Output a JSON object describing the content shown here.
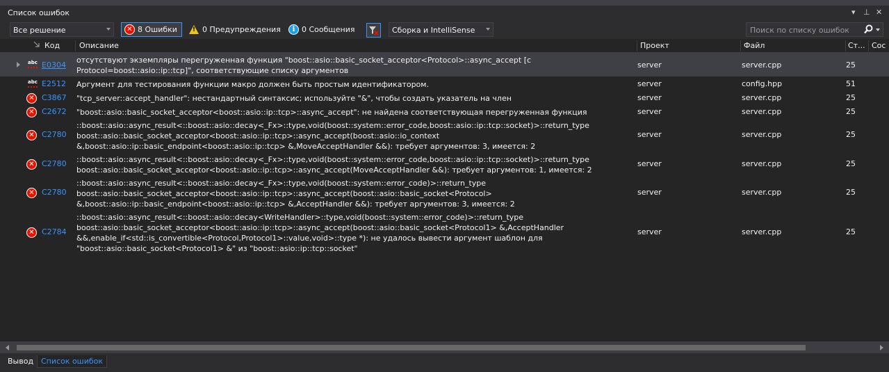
{
  "window": {
    "title": "Список ошибок"
  },
  "toolbar": {
    "scope": "Все решение",
    "errors": "8 Ошибки",
    "warnings": "0 Предупреждения",
    "messages": "0 Сообщения",
    "build_source": "Сборка и IntelliSense",
    "search_placeholder": "Поиск по списку ошибок"
  },
  "columns": {
    "code": "Код",
    "description": "Описание",
    "project": "Проект",
    "file": "Файл",
    "line": "Ст...",
    "suppression": "Сос"
  },
  "rows": [
    {
      "icon": "intellisense-error-icon",
      "code": "E0304",
      "description": "отсутствуют экземпляры перегруженная функция \"boost::asio::basic_socket_acceptor<Protocol>::async_accept [с Protocol=boost::asio::ip::tcp]\", соответствующие списку аргументов",
      "project": "server",
      "file": "server.cpp",
      "line": "25"
    },
    {
      "icon": "intellisense-error-icon",
      "code": "E2512",
      "description": "Аргумент для тестирования функции макро должен быть простым идентификатором.",
      "project": "server",
      "file": "config.hpp",
      "line": "51"
    },
    {
      "icon": "error-icon",
      "code": "C3867",
      "description": "\"tcp_server::accept_handler\": нестандартный синтаксис; используйте \"&\", чтобы создать указатель на член",
      "project": "server",
      "file": "server.cpp",
      "line": "25"
    },
    {
      "icon": "error-icon",
      "code": "C2672",
      "description": "\"boost::asio::basic_socket_acceptor<boost::asio::ip::tcp>::async_accept\": не найдена соответствующая перегруженная функция",
      "project": "server",
      "file": "server.cpp",
      "line": "25"
    },
    {
      "icon": "error-icon",
      "code": "C2780",
      "description": "::boost::asio::async_result<::boost::asio::decay<_Fx>::type,void(boost::system::error_code,boost::asio::ip::tcp::socket)>::return_type boost::asio::basic_socket_acceptor<boost::asio::ip::tcp>::async_accept(boost::asio::io_context &,boost::asio::ip::basic_endpoint<boost::asio::ip::tcp> &,MoveAcceptHandler &&): требует аргументов: 3, имеется: 2",
      "project": "server",
      "file": "server.cpp",
      "line": "25"
    },
    {
      "icon": "error-icon",
      "code": "C2780",
      "description": "::boost::asio::async_result<::boost::asio::decay<_Fx>::type,void(boost::system::error_code,boost::asio::ip::tcp::socket)>::return_type boost::asio::basic_socket_acceptor<boost::asio::ip::tcp>::async_accept(MoveAcceptHandler &&): требует аргументов: 1, имеется: 2",
      "project": "server",
      "file": "server.cpp",
      "line": "25"
    },
    {
      "icon": "error-icon",
      "code": "C2780",
      "description": "::boost::asio::async_result<::boost::asio::decay<_Fx>::type,void(boost::system::error_code)>::return_type boost::asio::basic_socket_acceptor<boost::asio::ip::tcp>::async_accept(boost::asio::basic_socket<Protocol> &,boost::asio::ip::basic_endpoint<boost::asio::ip::tcp> &,AcceptHandler &&): требует аргументов: 3, имеется: 2",
      "project": "server",
      "file": "server.cpp",
      "line": "25"
    },
    {
      "icon": "error-icon",
      "code": "C2784",
      "description": "::boost::asio::async_result<::boost::asio::decay<WriteHandler>::type,void(boost::system::error_code)>::return_type boost::asio::basic_socket_acceptor<boost::asio::ip::tcp>::async_accept(boost::asio::basic_socket<Protocol1> &,AcceptHandler &&,enable_if<std::is_convertible<Protocol,Protocol1>::value,void>::type *): не удалось вывести аргумент шаблон для \"boost::asio::basic_socket<Protocol1> &\" из \"boost::asio::ip::tcp::socket\"",
      "project": "server",
      "file": "server.cpp",
      "line": "25"
    }
  ],
  "bottom_tabs": [
    "Вывод",
    "Список ошибок"
  ],
  "colors": {
    "background": "#252526",
    "accent": "#3794ff",
    "error": "#e51400",
    "warning": "#f0c419",
    "info": "#1ba1e2"
  }
}
